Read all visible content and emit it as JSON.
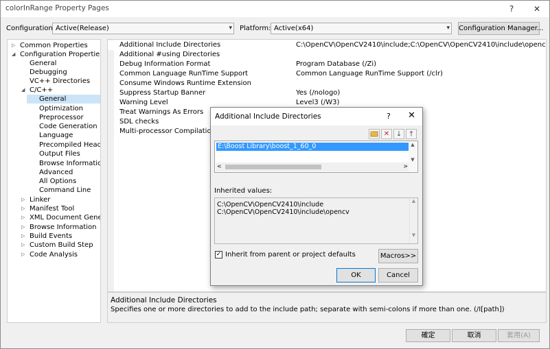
{
  "window": {
    "title": "colorInRange Property Pages",
    "help_glyph": "?",
    "close_glyph": "✕"
  },
  "toolbar": {
    "configuration_label": "Configuration:",
    "configuration_value": "Active(Release)",
    "platform_label": "Platform:",
    "platform_value": "Active(x64)",
    "config_manager_label": "Configuration Manager..."
  },
  "tree": {
    "items": [
      {
        "label": "Common Properties",
        "expander": "▷"
      },
      {
        "label": "Configuration Properties",
        "expander": "◢"
      },
      {
        "label": "General"
      },
      {
        "label": "Debugging"
      },
      {
        "label": "VC++ Directories"
      },
      {
        "label": "C/C++",
        "expander": "◢"
      },
      {
        "label": "General",
        "selected": true
      },
      {
        "label": "Optimization"
      },
      {
        "label": "Preprocessor"
      },
      {
        "label": "Code Generation"
      },
      {
        "label": "Language"
      },
      {
        "label": "Precompiled Headers"
      },
      {
        "label": "Output Files"
      },
      {
        "label": "Browse Information"
      },
      {
        "label": "Advanced"
      },
      {
        "label": "All Options"
      },
      {
        "label": "Command Line"
      },
      {
        "label": "Linker",
        "expander": "▷"
      },
      {
        "label": "Manifest Tool",
        "expander": "▷"
      },
      {
        "label": "XML Document Generator",
        "expander": "▷"
      },
      {
        "label": "Browse Information",
        "expander": "▷"
      },
      {
        "label": "Build Events",
        "expander": "▷"
      },
      {
        "label": "Custom Build Step",
        "expander": "▷"
      },
      {
        "label": "Code Analysis",
        "expander": "▷"
      }
    ]
  },
  "properties": [
    {
      "name": "Additional Include Directories",
      "value": "C:\\OpenCV\\OpenCV2410\\include;C:\\OpenCV\\OpenCV2410\\include\\opencv;%(Additi"
    },
    {
      "name": "Additional #using Directories",
      "value": ""
    },
    {
      "name": "Debug Information Format",
      "value": "Program Database (/Zi)"
    },
    {
      "name": "Common Language RunTime Support",
      "value": "Common Language RunTime Support (/clr)"
    },
    {
      "name": "Consume Windows Runtime Extension",
      "value": ""
    },
    {
      "name": "Suppress Startup Banner",
      "value": "Yes (/nologo)"
    },
    {
      "name": "Warning Level",
      "value": "Level3 (/W3)"
    },
    {
      "name": "Treat Warnings As Errors",
      "value": ""
    },
    {
      "name": "SDL checks",
      "value": ""
    },
    {
      "name": "Multi-processor Compilation",
      "value": ""
    }
  ],
  "description": {
    "title": "Additional Include Directories",
    "text": "Specifies one or more directories to add to the include path; separate with semi-colons if more than one.   (/I[path])"
  },
  "footer": {
    "ok_label": "確定",
    "cancel_label": "取消",
    "apply_label": "套用(A)"
  },
  "dialog": {
    "title": "Additional Include Directories",
    "help_glyph": "?",
    "close_glyph": "✕",
    "list_value": "E:\\Boost Library\\boost_1_60_0",
    "inherited_label": "Inherited values:",
    "inherited_values": [
      "C:\\OpenCV\\OpenCV2410\\include",
      "C:\\OpenCV\\OpenCV2410\\include\\opencv"
    ],
    "inherit_checkbox_label": "Inherit from parent or project defaults",
    "inherit_checked": true,
    "macros_label": "Macros>>",
    "ok_label": "OK",
    "cancel_label": "Cancel"
  }
}
